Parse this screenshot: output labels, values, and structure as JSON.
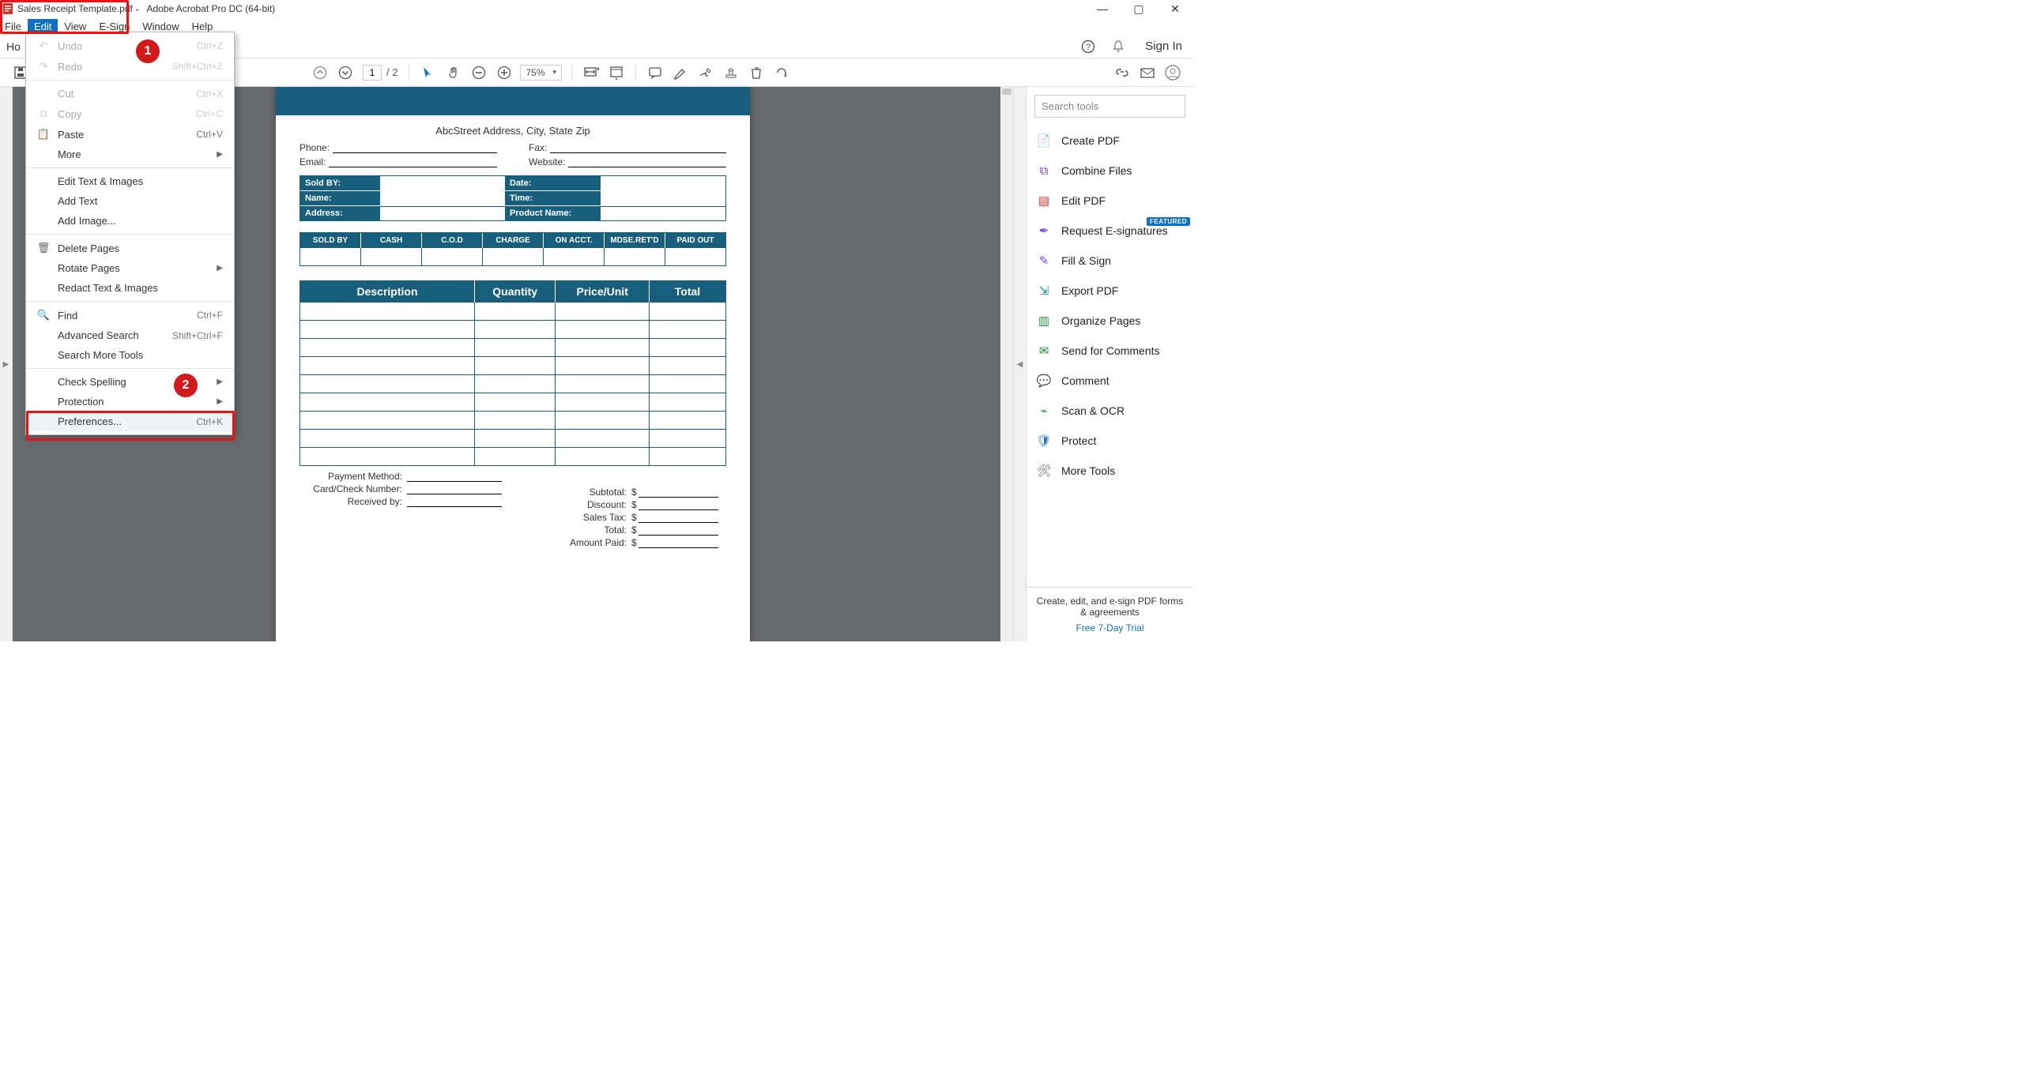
{
  "window": {
    "doc_title": "Sales Receipt Template.pdf",
    "app_title": "Adobe Acrobat Pro DC (64-bit)",
    "controls": {
      "minimize": "—",
      "maximize": "▢",
      "close": "✕"
    }
  },
  "menubar": {
    "items": [
      "File",
      "Edit",
      "View",
      "E-Sign",
      "Window",
      "Help"
    ],
    "selected_index": 1
  },
  "tabbar": {
    "home": "Ho",
    "sign_in": "Sign In"
  },
  "toolbar": {
    "page_current": "1",
    "page_total": "/  2",
    "zoom": "75%"
  },
  "edit_menu": [
    {
      "type": "item",
      "icon": "↶",
      "label": "Undo",
      "shortcut": "Ctrl+Z",
      "disabled": true
    },
    {
      "type": "item",
      "icon": "↷",
      "label": "Redo",
      "shortcut": "Shift+Ctrl+Z",
      "disabled": true
    },
    {
      "type": "sep"
    },
    {
      "type": "item",
      "icon": "",
      "label": "Cut",
      "shortcut": "Ctrl+X",
      "disabled": true
    },
    {
      "type": "item",
      "icon": "⧉",
      "label": "Copy",
      "shortcut": "Ctrl+C",
      "disabled": true
    },
    {
      "type": "item",
      "icon": "📋",
      "label": "Paste",
      "shortcut": "Ctrl+V"
    },
    {
      "type": "item",
      "icon": "",
      "label": "More",
      "submenu": true
    },
    {
      "type": "sep"
    },
    {
      "type": "item",
      "icon": "",
      "label": "Edit Text & Images"
    },
    {
      "type": "item",
      "icon": "",
      "label": "Add Text"
    },
    {
      "type": "item",
      "icon": "",
      "label": "Add Image..."
    },
    {
      "type": "sep"
    },
    {
      "type": "item",
      "icon": "🗑",
      "label": "Delete Pages"
    },
    {
      "type": "item",
      "icon": "",
      "label": "Rotate Pages",
      "submenu": true
    },
    {
      "type": "item",
      "icon": "",
      "label": "Redact Text & Images"
    },
    {
      "type": "sep"
    },
    {
      "type": "item",
      "icon": "🔍",
      "label": "Find",
      "shortcut": "Ctrl+F"
    },
    {
      "type": "item",
      "icon": "",
      "label": "Advanced Search",
      "shortcut": "Shift+Ctrl+F"
    },
    {
      "type": "item",
      "icon": "",
      "label": "Search More Tools"
    },
    {
      "type": "sep"
    },
    {
      "type": "item",
      "icon": "",
      "label": "Check Spelling",
      "submenu": true
    },
    {
      "type": "item",
      "icon": "",
      "label": "Protection",
      "submenu": true
    },
    {
      "type": "item",
      "icon": "",
      "label": "Preferences...",
      "shortcut": "Ctrl+K",
      "hover": true
    }
  ],
  "receipt": {
    "address_line": "AbcStreet Address, City, State Zip",
    "contact_labels": {
      "phone": "Phone:",
      "fax": "Fax:",
      "email": "Email:",
      "website": "Website:"
    },
    "info_rows": [
      {
        "l": "Sold BY:",
        "r": "Date:"
      },
      {
        "l": "Name:",
        "r": "Time:"
      },
      {
        "l": "Address:",
        "r": "Product Name:",
        "double": true
      }
    ],
    "pay_methods": [
      "SOLD BY",
      "CASH",
      "C.O.D",
      "CHARGE",
      "ON ACCT.",
      "MDSE.RET'D",
      "PAID OUT"
    ],
    "item_headers": [
      "Description",
      "Quantity",
      "Price/Unit",
      "Total"
    ],
    "item_row_count": 9,
    "totals": [
      "Subtotal:",
      "Discount:",
      "Sales Tax:",
      "Total:",
      "Amount Paid:"
    ],
    "pay_footer": [
      "Payment Method:",
      "Card/Check Number:",
      "Received by:"
    ]
  },
  "tools": {
    "search_placeholder": "Search tools",
    "featured_label": "FEATURED",
    "list": [
      {
        "icon": "📄",
        "color": "c-red",
        "label": "Create PDF"
      },
      {
        "icon": "⧉",
        "color": "c-purple",
        "label": "Combine Files"
      },
      {
        "icon": "▤",
        "color": "c-red",
        "label": "Edit PDF"
      },
      {
        "icon": "✒",
        "color": "c-purple",
        "label": "Request E-signatures",
        "featured": true
      },
      {
        "icon": "✎",
        "color": "c-purple",
        "label": "Fill & Sign"
      },
      {
        "icon": "⇲",
        "color": "c-teal",
        "label": "Export PDF"
      },
      {
        "icon": "▥",
        "color": "c-green",
        "label": "Organize Pages"
      },
      {
        "icon": "✉",
        "color": "c-green",
        "label": "Send for Comments"
      },
      {
        "icon": "💬",
        "color": "c-yellow",
        "label": "Comment"
      },
      {
        "icon": "⌁",
        "color": "c-green",
        "label": "Scan & OCR"
      },
      {
        "icon": "🛡",
        "color": "c-blue",
        "label": "Protect"
      },
      {
        "icon": "🛠",
        "color": "c-gray",
        "label": "More Tools"
      }
    ],
    "footer": {
      "heading": "Create, edit, and e-sign PDF forms & agreements",
      "link": "Free 7-Day Trial"
    }
  },
  "callouts": {
    "num1": "1",
    "num2": "2"
  }
}
